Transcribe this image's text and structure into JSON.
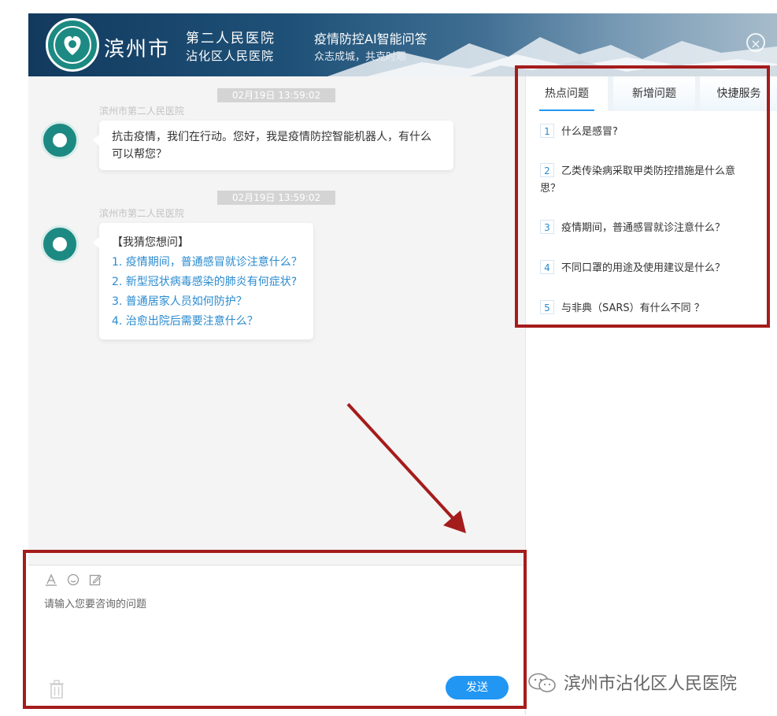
{
  "header": {
    "hospital_city": "滨州市",
    "hospital_name_line1": "第二人民医院",
    "hospital_name_line2": "沾化区人民医院",
    "app_title": "疫情防控AI智能问答",
    "app_subtitle": "众志成城，共克时艰",
    "close_label": "×"
  },
  "chat": {
    "messages": [
      {
        "timestamp": "02月19日 13:59:02",
        "sender": "滨州市第二人民医院",
        "text": "抗击疫情，我们在行动。您好，我是疫情防控智能机器人，有什么可以帮您？"
      },
      {
        "timestamp": "02月19日 13:59:02",
        "sender": "滨州市第二人民医院",
        "heading": "【我猜您想问】",
        "suggestions": [
          "1. 疫情期间，普通感冒就诊注意什么？",
          "2. 新型冠状病毒感染的肺炎有何症状?",
          "3. 普通居家人员如何防护？",
          "4. 治愈出院后需要注意什么？"
        ]
      }
    ]
  },
  "input": {
    "toolbar_icons": [
      "font-icon",
      "emoji-icon",
      "edit-icon"
    ],
    "placeholder": "请输入您要咨询的问题",
    "send_label": "发送"
  },
  "panel": {
    "tabs": [
      {
        "label": "热点问题",
        "active": true
      },
      {
        "label": "新增问题",
        "active": false
      },
      {
        "label": "快捷服务",
        "active": false
      }
    ],
    "questions": [
      {
        "num": "1",
        "text": "什么是感冒?"
      },
      {
        "num": "2",
        "text": "乙类传染病采取甲类防控措施是什么意思？"
      },
      {
        "num": "3",
        "text": "疫情期间，普通感冒就诊注意什么？"
      },
      {
        "num": "4",
        "text": "不同口罩的用途及使用建议是什么？"
      },
      {
        "num": "5",
        "text": "与非典（SARS）有什么不同 ？"
      }
    ]
  },
  "watermark": "滨州市沾化区人民医院",
  "colors": {
    "accent": "#2196f3",
    "link": "#2a8bd0",
    "annotation": "#a51c1c",
    "brand_green": "#1c8a82"
  }
}
